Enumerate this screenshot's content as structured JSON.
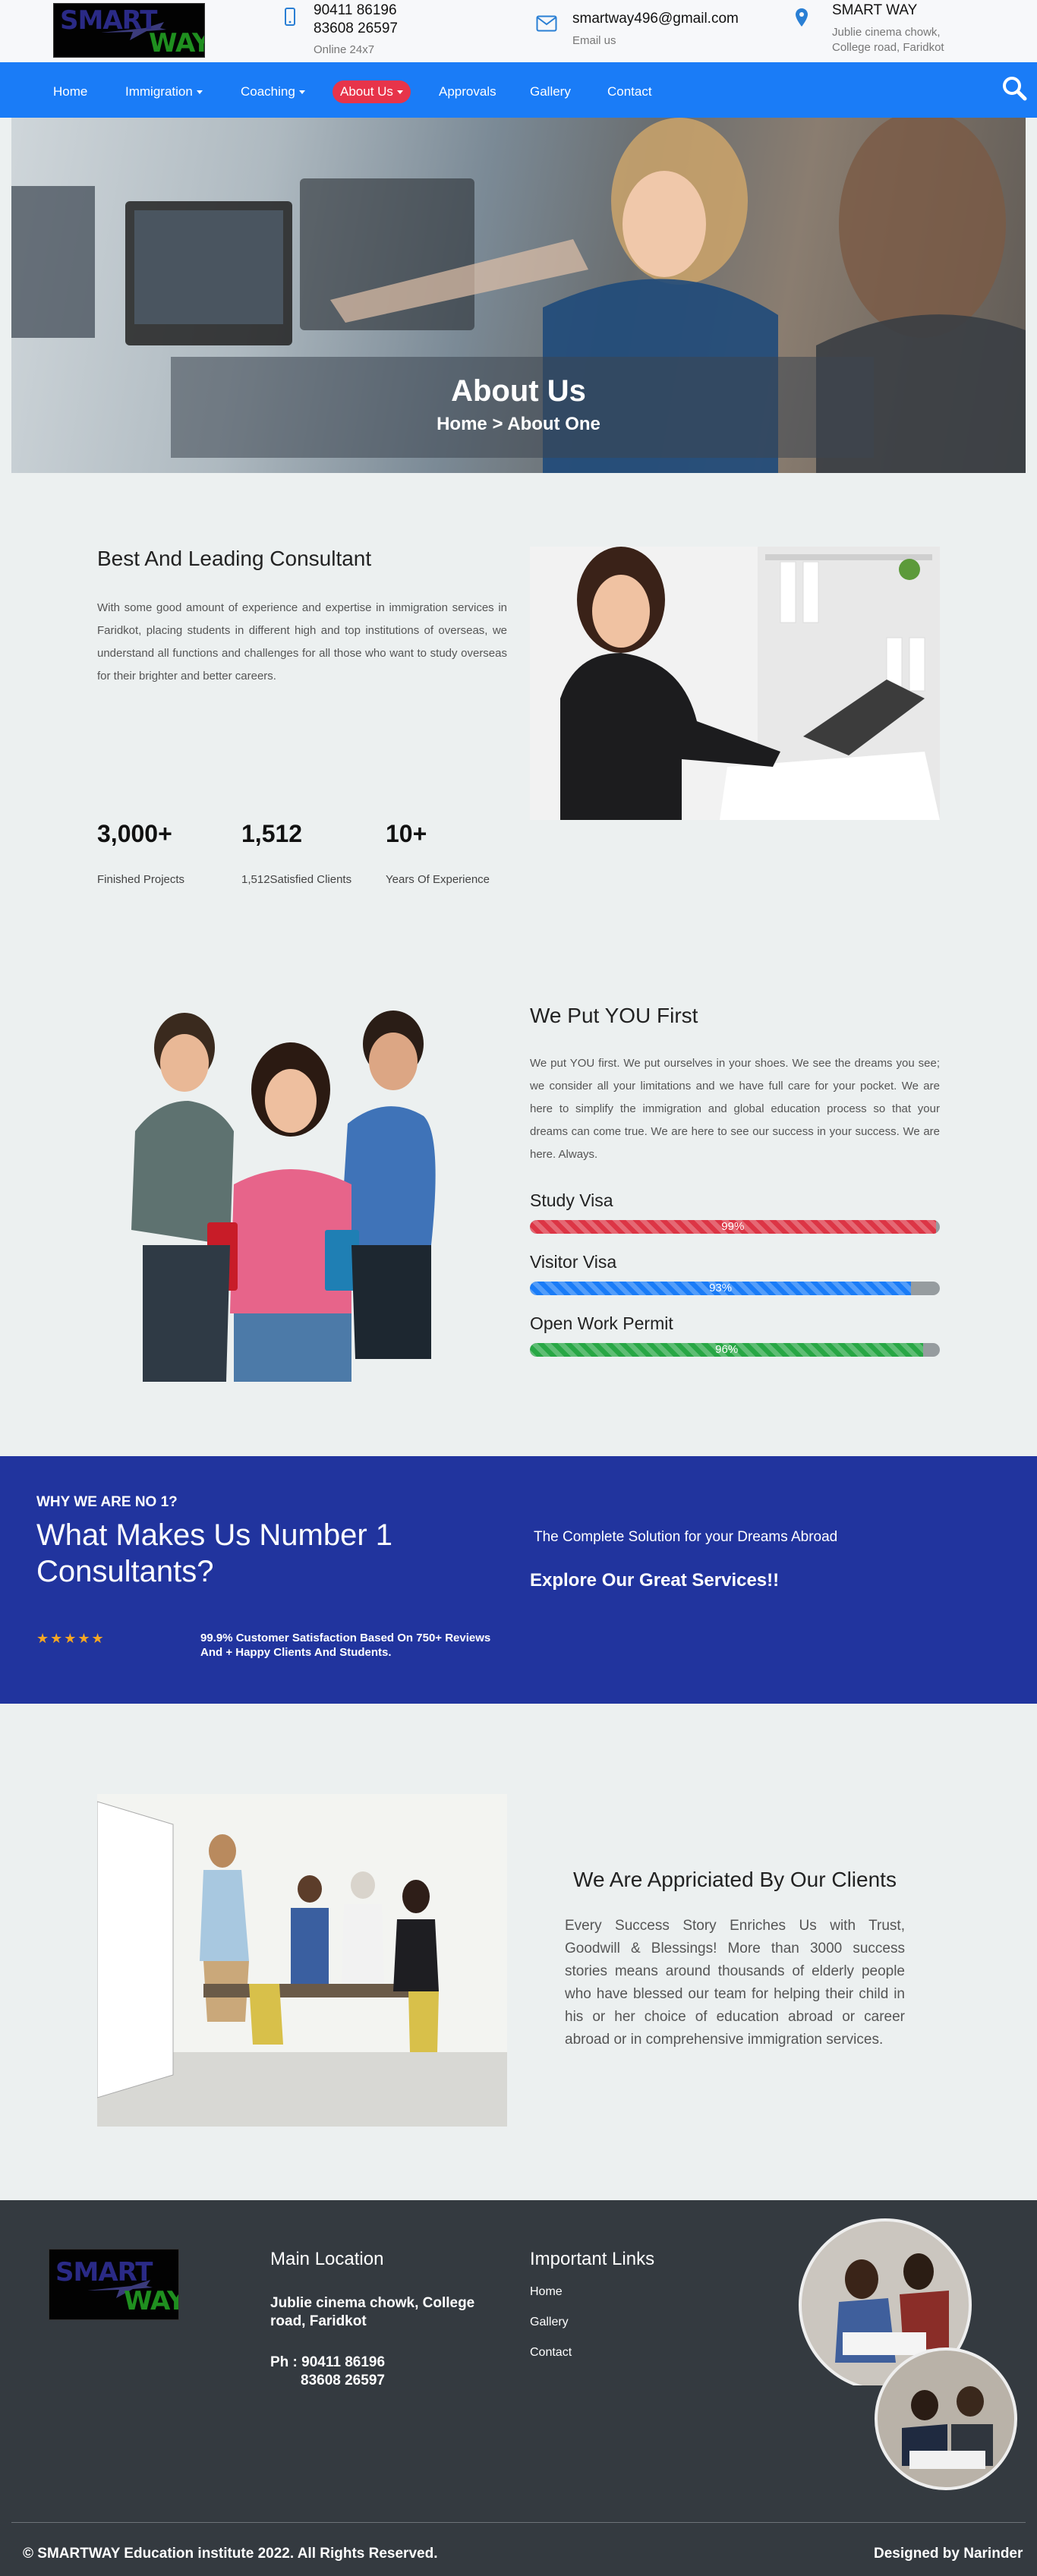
{
  "header": {
    "logo_text_1": "SMART",
    "logo_text_2": "WAY",
    "phone_1": "90411 86196",
    "phone_2": "83608 26597",
    "phone_sub": "Online 24x7",
    "email": "smartway496@gmail.com",
    "email_sub": "Email us",
    "location_title": "SMART WAY",
    "location_line_1": "Jublie cinema chowk,",
    "location_line_2": "College road, Faridkot"
  },
  "nav": {
    "items": [
      {
        "label": "Home"
      },
      {
        "label": "Immigration"
      },
      {
        "label": "Coaching"
      },
      {
        "label": "About Us"
      },
      {
        "label": "Approvals"
      },
      {
        "label": "Gallery"
      },
      {
        "label": "Contact"
      }
    ],
    "active_color": "#e7344a",
    "bar_color": "#1a7cf7"
  },
  "hero": {
    "title": "About Us",
    "breadcrumb": "Home > About One"
  },
  "about": {
    "title": "Best And Leading Consultant",
    "text": "With some good amount of experience and expertise in immigration services in Faridkot, placing students in different high and top institutions of overseas, we understand all functions and challenges for all those who want to study overseas for their brighter and better careers.",
    "stats": [
      {
        "value": "3,000+",
        "label": "Finished Projects"
      },
      {
        "value": "1,512",
        "label": "1,512Satisfied Clients"
      },
      {
        "value": "10+",
        "label": "Years Of Experience"
      }
    ]
  },
  "first": {
    "title": "We Put YOU First",
    "text": "We put YOU first. We put ourselves in your shoes. We see the dreams you see; we consider all your limitations and we have full care for your pocket. We are here to simplify the immigration and global education process so that your dreams can come true. We are here to see our success in your success. We are here. Always.",
    "skills": [
      {
        "label": "Study Visa",
        "percent": 99,
        "percent_text": "99%",
        "color": "#dc3545"
      },
      {
        "label": "Visitor Visa",
        "percent": 93,
        "percent_text": "93%",
        "color": "#1a7cf7"
      },
      {
        "label": "Open Work Permit",
        "percent": 96,
        "percent_text": "96%",
        "color": "#28a745"
      }
    ]
  },
  "band": {
    "kicker": "WHY WE ARE NO 1?",
    "title_1": "What Makes Us Number 1",
    "title_2": "Consultants?",
    "review_line_1": "99.9% Customer Satisfaction Based On 750+ Reviews",
    "review_line_2": "And + Happy Clients And Students.",
    "right_1": "The Complete Solution for your Dreams Abroad",
    "right_2": "Explore Our Great Services!!",
    "stars": "★★★★★"
  },
  "clients": {
    "title": "We Are Appriciated By Our Clients",
    "text": "Every Success Story Enriches Us with Trust, Goodwill & Blessings! More than 3000 success stories means around thousands of elderly people who have blessed our team for helping their child in his or her choice of education abroad or career abroad or in comprehensive immigration services."
  },
  "footer": {
    "location_head": "Main Location",
    "address_1": "Jublie cinema chowk, College",
    "address_2": "road, Faridkot",
    "phone_line_1": "Ph : 90411 86196",
    "phone_line_2": "83608 26597",
    "links_head": "Important Links",
    "links": [
      "Home",
      "Gallery",
      "Contact"
    ],
    "copyright": "© SMARTWAY Education institute 2022. All Rights Reserved.",
    "designer": "Designed by Narinder"
  }
}
